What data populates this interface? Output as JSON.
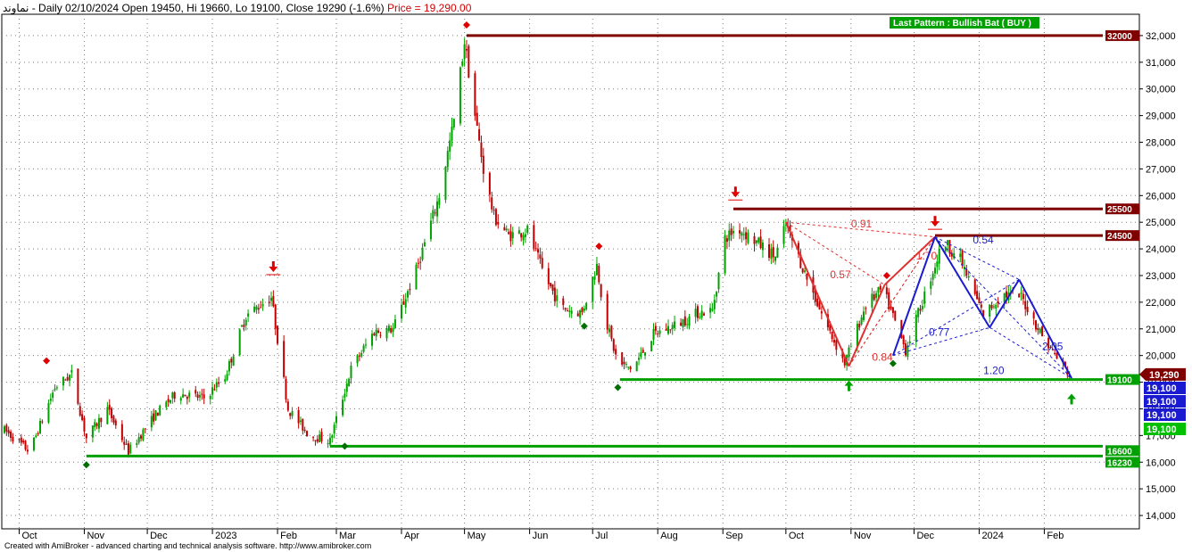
{
  "header": {
    "symbol": "نماوند",
    "info": " - Daily 02/10/2024 Open 19450, Hi 19660, Lo 19100, Close 19290 (-1.6%) ",
    "price_text": "Price = 19,290.00"
  },
  "footer": {
    "text": "Created with AmiBroker - advanced charting and technical analysis software. http://www.amibroker.com"
  },
  "pattern_label": "Last Pattern : Bullish Bat ( BUY )",
  "colors": {
    "up": "#00a000",
    "down": "#c00000",
    "level_red": "#800000",
    "level_green": "#00a000",
    "pattern_red": "#e03030",
    "pattern_blue": "#1a1ad0",
    "grid": "#7f7f7f"
  },
  "chart_data": {
    "type": "candlestick",
    "y_axis_side": "right",
    "ylim": [
      13500,
      32800
    ],
    "y_ticks": [
      14000,
      15000,
      16000,
      17000,
      18000,
      19000,
      20000,
      21000,
      22000,
      23000,
      24000,
      25000,
      26000,
      27000,
      28000,
      29000,
      30000,
      31000,
      32000
    ],
    "y_tick_labels": [
      "14,000",
      "15,000",
      "16,000",
      "17,000",
      "18,000",
      "19,000",
      "20,000",
      "21,000",
      "22,000",
      "23,000",
      "24,000",
      "25,000",
      "26,000",
      "27,000",
      "28,000",
      "29,000",
      "30,000",
      "31,000",
      "32,000"
    ],
    "x_labels": [
      "Oct",
      "Nov",
      "Dec",
      "2023",
      "Feb",
      "Mar",
      "Apr",
      "May",
      "Jun",
      "Jul",
      "Aug",
      "Sep",
      "Oct",
      "Nov",
      "Dec",
      "2024",
      "Feb"
    ],
    "x_label_dates": [
      "2022-10-01",
      "2022-11-01",
      "2022-12-01",
      "2023-01-01",
      "2023-02-01",
      "2023-03-01",
      "2023-04-01",
      "2023-05-01",
      "2023-06-01",
      "2023-07-01",
      "2023-08-01",
      "2023-09-01",
      "2023-10-01",
      "2023-11-01",
      "2023-12-01",
      "2024-01-01",
      "2024-02-01"
    ],
    "x_range": [
      "2022-09-24",
      "2024-02-28"
    ],
    "last_close": 19290,
    "last_close_label": "19,290",
    "price_path": [
      {
        "date": "2022-09-24",
        "price": 17200
      },
      {
        "date": "2022-10-06",
        "price": 16400
      },
      {
        "date": "2022-10-18",
        "price": 18800
      },
      {
        "date": "2022-10-26",
        "price": 19300
      },
      {
        "date": "2022-11-02",
        "price": 16900
      },
      {
        "date": "2022-11-12",
        "price": 18000
      },
      {
        "date": "2022-11-22",
        "price": 16400
      },
      {
        "date": "2022-12-05",
        "price": 17800
      },
      {
        "date": "2022-12-15",
        "price": 18600
      },
      {
        "date": "2022-12-28",
        "price": 18400
      },
      {
        "date": "2023-01-07",
        "price": 19200
      },
      {
        "date": "2023-01-17",
        "price": 21500
      },
      {
        "date": "2023-01-29",
        "price": 22200
      },
      {
        "date": "2023-02-06",
        "price": 18000
      },
      {
        "date": "2023-02-16",
        "price": 17000
      },
      {
        "date": "2023-02-26",
        "price": 16800
      },
      {
        "date": "2023-03-08",
        "price": 19500
      },
      {
        "date": "2023-03-19",
        "price": 20900
      },
      {
        "date": "2023-03-28",
        "price": 21000
      },
      {
        "date": "2023-04-08",
        "price": 23200
      },
      {
        "date": "2023-04-19",
        "price": 26000
      },
      {
        "date": "2023-04-26",
        "price": 28800
      },
      {
        "date": "2023-05-01",
        "price": 31800
      },
      {
        "date": "2023-05-06",
        "price": 29000
      },
      {
        "date": "2023-05-10",
        "price": 27000
      },
      {
        "date": "2023-05-15",
        "price": 25200
      },
      {
        "date": "2023-05-22",
        "price": 24500
      },
      {
        "date": "2023-05-31",
        "price": 24700
      },
      {
        "date": "2023-06-08",
        "price": 23000
      },
      {
        "date": "2023-06-16",
        "price": 21800
      },
      {
        "date": "2023-06-26",
        "price": 21600
      },
      {
        "date": "2023-07-03",
        "price": 23400
      },
      {
        "date": "2023-07-07",
        "price": 21400
      },
      {
        "date": "2023-07-13",
        "price": 19700
      },
      {
        "date": "2023-07-20",
        "price": 19500
      },
      {
        "date": "2023-07-30",
        "price": 20800
      },
      {
        "date": "2023-08-11",
        "price": 21200
      },
      {
        "date": "2023-08-20",
        "price": 21600
      },
      {
        "date": "2023-08-27",
        "price": 21700
      },
      {
        "date": "2023-09-02",
        "price": 24400
      },
      {
        "date": "2023-09-08",
        "price": 24800
      },
      {
        "date": "2023-09-18",
        "price": 24200
      },
      {
        "date": "2023-09-26",
        "price": 23700
      },
      {
        "date": "2023-10-01",
        "price": 24900
      },
      {
        "date": "2023-10-11",
        "price": 22900
      },
      {
        "date": "2023-10-20",
        "price": 21200
      },
      {
        "date": "2023-10-29",
        "price": 19700
      },
      {
        "date": "2023-11-08",
        "price": 21900
      },
      {
        "date": "2023-11-16",
        "price": 22500
      },
      {
        "date": "2023-11-27",
        "price": 20200
      },
      {
        "date": "2023-12-07",
        "price": 22500
      },
      {
        "date": "2023-12-15",
        "price": 24300
      },
      {
        "date": "2023-12-23",
        "price": 23600
      },
      {
        "date": "2024-01-03",
        "price": 21500
      },
      {
        "date": "2024-01-12",
        "price": 22300
      },
      {
        "date": "2024-01-21",
        "price": 22200
      },
      {
        "date": "2024-02-01",
        "price": 20600
      },
      {
        "date": "2024-02-08",
        "price": 19800
      },
      {
        "date": "2024-02-13",
        "price": 19290
      }
    ],
    "levels": [
      {
        "value": 32000,
        "label": "32000",
        "color": "#800000",
        "from": "2023-05-02"
      },
      {
        "value": 25500,
        "label": "25500",
        "color": "#800000",
        "from": "2023-09-06"
      },
      {
        "value": 24500,
        "label": "24500",
        "color": "#800000",
        "from": "2023-12-11"
      },
      {
        "value": 19100,
        "label": "19100",
        "color": "#00a000",
        "from": "2023-07-14"
      },
      {
        "value": 16600,
        "label": "16600",
        "color": "#00a000",
        "from": "2023-02-26"
      },
      {
        "value": 16230,
        "label": "16230",
        "color": "#00a000",
        "from": "2022-11-02"
      }
    ],
    "price_tags": [
      {
        "text": "19,100",
        "color": "#1a1ad0"
      },
      {
        "text": "19,100",
        "color": "#1a1ad0"
      },
      {
        "text": "19,100",
        "color": "#1a1ad0"
      },
      {
        "text": "19,100",
        "color": "#00c000"
      }
    ],
    "pattern_red": {
      "points": [
        {
          "date": "2023-10-01",
          "price": 25000
        },
        {
          "date": "2023-10-31",
          "price": 19600
        },
        {
          "date": "2023-11-17",
          "price": 22650
        },
        {
          "date": "2023-12-11",
          "price": 24450
        }
      ],
      "ratios": [
        {
          "text": "0.91",
          "date": "2023-11-01",
          "price": 24800
        },
        {
          "text": "0.57",
          "date": "2023-10-22",
          "price": 22900
        },
        {
          "text": "1.70",
          "date": "2023-12-02",
          "price": 23600
        },
        {
          "text": "0.84",
          "date": "2023-11-11",
          "price": 19800
        }
      ]
    },
    "pattern_blue": {
      "points": [
        {
          "date": "2023-11-21",
          "price": 20000
        },
        {
          "date": "2023-12-11",
          "price": 24450
        },
        {
          "date": "2024-01-06",
          "price": 21050
        },
        {
          "date": "2024-01-20",
          "price": 22850
        },
        {
          "date": "2024-02-14",
          "price": 19150
        }
      ],
      "ratios": [
        {
          "text": "0.54",
          "date": "2023-12-29",
          "price": 24200
        },
        {
          "text": "0.77",
          "date": "2023-12-08",
          "price": 20750
        },
        {
          "text": "2.05",
          "date": "2024-01-31",
          "price": 20200
        },
        {
          "text": "1.20",
          "date": "2024-01-03",
          "price": 19300
        }
      ]
    },
    "markers": [
      {
        "kind": "diamond-red",
        "date": "2022-10-14",
        "price": 19800
      },
      {
        "kind": "diamond-green",
        "date": "2022-11-02",
        "price": 15900
      },
      {
        "kind": "arrow-down-red",
        "date": "2023-01-30",
        "price": 23200
      },
      {
        "kind": "diamond-green",
        "date": "2023-03-05",
        "price": 16600
      },
      {
        "kind": "diamond-red",
        "date": "2023-05-02",
        "price": 32400
      },
      {
        "kind": "diamond-green",
        "date": "2023-06-27",
        "price": 21100
      },
      {
        "kind": "diamond-red",
        "date": "2023-07-04",
        "price": 24100
      },
      {
        "kind": "diamond-green",
        "date": "2023-07-13",
        "price": 18800
      },
      {
        "kind": "arrow-down-red",
        "date": "2023-09-07",
        "price": 26000
      },
      {
        "kind": "arrow-up-green",
        "date": "2023-10-31",
        "price": 19000
      },
      {
        "kind": "diamond-red",
        "date": "2023-11-18",
        "price": 23000
      },
      {
        "kind": "diamond-green",
        "date": "2023-11-21",
        "price": 19700
      },
      {
        "kind": "arrow-down-red",
        "date": "2023-12-11",
        "price": 24900
      },
      {
        "kind": "arrow-up-green",
        "date": "2024-02-14",
        "price": 18500
      }
    ]
  }
}
